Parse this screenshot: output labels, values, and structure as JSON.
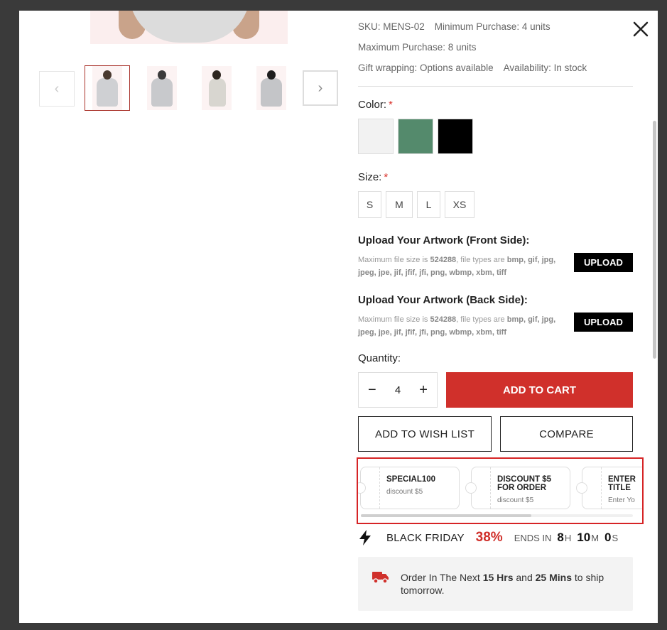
{
  "product": {
    "sku": "SKU: MENS-02",
    "min_purchase": "Minimum Purchase: 4 units",
    "max_purchase": "Maximum Purchase: 8 units",
    "gift_wrapping": "Gift wrapping: Options available",
    "availability": "Availability: In stock"
  },
  "color": {
    "label": "Color:",
    "required": "*",
    "swatches": [
      "#f2f2f2",
      "#548a6c",
      "#000000"
    ]
  },
  "size": {
    "label": "Size:",
    "required": "*",
    "options": [
      "S",
      "M",
      "L",
      "XS"
    ]
  },
  "upload_front": {
    "title": "Upload Your Artwork (Front Side):",
    "note_prefix": "Maximum file size is ",
    "size": "524288",
    "note_mid": ", file types are ",
    "types": "bmp, gif, jpg, jpeg, jpe, jif, jfif, jfi, png, wbmp, xbm, tiff",
    "button": "UPLOAD"
  },
  "upload_back": {
    "title": "Upload Your Artwork (Back Side):",
    "note_prefix": "Maximum file size is ",
    "size": "524288",
    "note_mid": ", file types are ",
    "types": "bmp, gif, jpg, jpeg, jpe, jif, jfif, jfi, png, wbmp, xbm, tiff",
    "button": "UPLOAD"
  },
  "quantity": {
    "label": "Quantity:",
    "value": "4",
    "minus": "−",
    "plus": "+"
  },
  "actions": {
    "add_to_cart": "ADD TO CART",
    "wish_list": "ADD TO WISH LIST",
    "compare": "COMPARE"
  },
  "coupons": [
    {
      "title": "SPECIAL100",
      "sub": "discount $5"
    },
    {
      "title": "DISCOUNT $5 FOR ORDER",
      "sub": "discount $5"
    },
    {
      "title": "ENTER TITLE",
      "sub": "Enter Yo"
    }
  ],
  "black_friday": {
    "label": "BLACK FRIDAY",
    "percent": "38%",
    "ends_in": "ENDS IN",
    "hours": "8",
    "h_unit": "H",
    "minutes": "10",
    "m_unit": "M",
    "seconds": "0",
    "s_unit": "S"
  },
  "shipping": {
    "prefix": "Order In The Next ",
    "hrs": "15 Hrs",
    "and": " and ",
    "mins": "25 Mins",
    "suffix": " to ship tomorrow."
  },
  "icons": {
    "close": "close-icon",
    "prev": "chevron-left-icon",
    "next": "chevron-right-icon",
    "bolt": "lightning-icon",
    "truck": "truck-icon"
  },
  "colors": {
    "accent": "#d0302b",
    "highlight_border": "#d62426"
  }
}
